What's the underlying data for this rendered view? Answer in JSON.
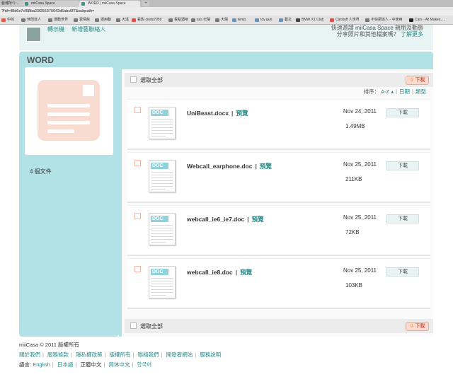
{
  "browser": {
    "tabs": [
      {
        "label": "藝博所介..."
      },
      {
        "label": "miiCasa Space"
      },
      {
        "label": "WORD | miiCasa Space"
      }
    ],
    "newtab_label": "+",
    "url": "?fid=48d6e7cf58ba23f256370042d5abc5f7&subpath=",
    "bookmarks": [
      "中控",
      "休閒達人",
      "運動世界",
      "愛情館",
      "運用動",
      "大溪",
      "看影-cindy7059",
      "看點酒吧",
      "sas 天陽",
      "大陽",
      "temp",
      "toy gun",
      "藝文",
      "BMW X1 Club",
      "Carstuff 人世界",
      "不快把達人 - 中使用",
      "Cars - All Makes, ..."
    ]
  },
  "top": {
    "user_links": [
      "轉示機",
      "新增藝聯絡人"
    ],
    "invite_text": "快速邀請 miiCasa Space 親朋及動態",
    "invite_text2": "分享照片和其他檔案嗎？",
    "invite_link": "了解更多"
  },
  "section": {
    "title": "WORD",
    "doc_count": "4 個文件"
  },
  "toolbar": {
    "select_all": "選取全部",
    "download": "下載",
    "sort_label": "排序：",
    "sort_options": [
      "A-Z ▴",
      "日期",
      "類型"
    ]
  },
  "files": [
    {
      "name": "UniBeast.docx",
      "preview": "預覽",
      "date": "Nov 24, 2011",
      "size": "1.49MB",
      "download": "下載",
      "type_label": "DOC"
    },
    {
      "name": "Webcall_earphone.doc",
      "preview": "預覽",
      "date": "Nov 25, 2011",
      "size": "211KB",
      "download": "下載",
      "type_label": "DOC"
    },
    {
      "name": "webcall_ie6_ie7.doc",
      "preview": "預覽",
      "date": "Nov 25, 2011",
      "size": "72KB",
      "download": "下載",
      "type_label": "DOC"
    },
    {
      "name": "webcall_ie8.doc",
      "preview": "預覽",
      "date": "Nov 25, 2011",
      "size": "103KB",
      "download": "下載",
      "type_label": "DOC"
    }
  ],
  "footer": {
    "copyright": "miiCasa © 2011   版權所有",
    "links": [
      "關於我們",
      "服務條款",
      "隱私權政策",
      "版權所有",
      "聯絡我們",
      "開發者網站",
      "服務說明"
    ],
    "lang_label": "語言:",
    "languages": [
      "English",
      "日本語",
      "正體中文",
      "简体中文",
      "한국어"
    ],
    "current_language": "正體中文"
  },
  "colors": {
    "accent": "#2a8a8a",
    "panel_bg": "#b3e2e6",
    "download_primary": "#fbd9cc"
  }
}
